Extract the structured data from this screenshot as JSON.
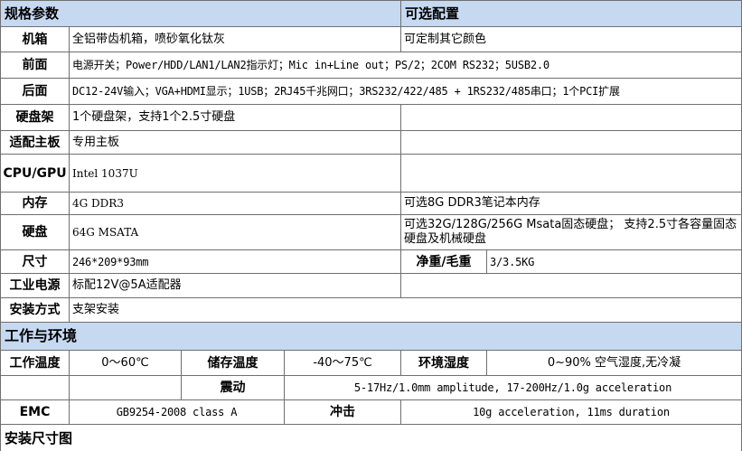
{
  "sections": {
    "spec_title": "规格参数",
    "options_title": "可选配置",
    "environment_title": "工作与环境",
    "install_diagram_title": "安装尺寸图"
  },
  "specs": [
    {
      "label": "机箱",
      "value": "全铝带齿机箱，喷砂氧化钛灰",
      "option": "可定制其它颜色"
    },
    {
      "label": "前面",
      "value": "电源开关；Power/HDD/LAN1/LAN2指示灯；Mic in+Line out；PS/2；2COM RS232；5USB2.0"
    },
    {
      "label": "后面",
      "value": "DC12-24V输入；VGA+HDMI显示；1USB；2RJ45千兆网口；3RS232/422/485 + 1RS232/485串口；1个PCI扩展"
    },
    {
      "label": "硬盘架",
      "value": "1个硬盘架，支持1个2.5寸硬盘",
      "option": ""
    },
    {
      "label": "适配主板",
      "value": "专用主板",
      "option": ""
    },
    {
      "label": "CPU/GPU",
      "value": "Intel 1037U",
      "option": ""
    },
    {
      "label": "内存",
      "value": "4G DDR3",
      "option": "可选8G DDR3笔记本内存"
    },
    {
      "label": "硬盘",
      "value": "64G MSATA",
      "option": "可选32G/128G/256G Msata固态硬盘； 支持2.5寸各容量固态硬盘及机械硬盘"
    },
    {
      "label": "尺寸",
      "value": "246*209*93mm",
      "extra_label": "净重/毛重",
      "extra_value": "3/3.5KG"
    },
    {
      "label": "工业电源",
      "value": "标配12V@5A适配器",
      "option": ""
    },
    {
      "label": "安装方式",
      "value": "支架安装"
    }
  ],
  "environment": {
    "work_temp_label": "工作温度",
    "work_temp_value": "0～60℃",
    "storage_temp_label": "储存温度",
    "storage_temp_value": "-40～75℃",
    "humidity_label": "环境湿度",
    "humidity_value": "0~90% 空气湿度,无冷凝",
    "vibration_label": "震动",
    "vibration_value": "5-17Hz/1.0mm amplitude, 17-200Hz/1.0g acceleration",
    "emc_label": "EMC",
    "emc_value": "GB9254-2008 class A",
    "shock_label": "冲击",
    "shock_value": "10g acceleration, 11ms duration"
  }
}
